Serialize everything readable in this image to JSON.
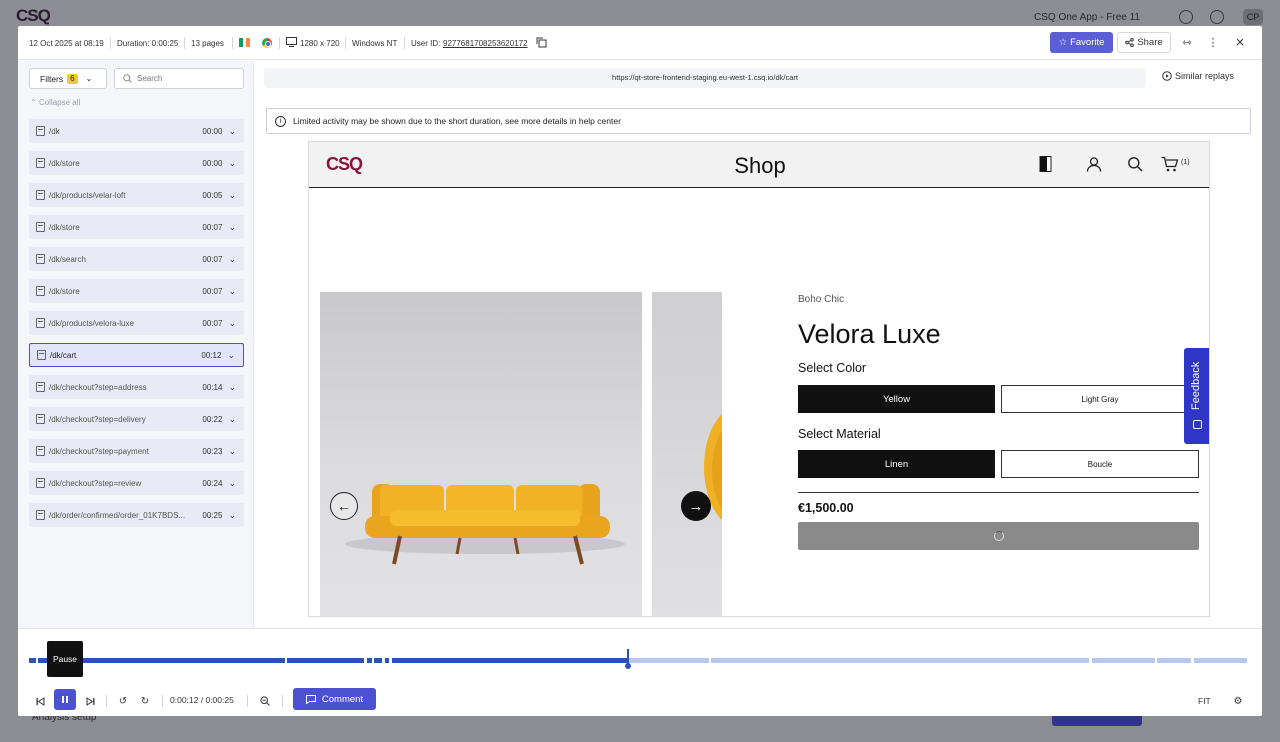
{
  "background": {
    "logo": "CSQ",
    "app_name": "CSQ One App - Free 11",
    "avatar": "CP",
    "bottom_left": "Analysis setup"
  },
  "header": {
    "date": "12 Oct 2025 at 08:19",
    "duration": "Duration: 0:00:25",
    "pages_count": "13 pages",
    "resolution": "1280 x 720",
    "os": "Windows NT",
    "user_id_label": "User ID:",
    "user_id": "9277681708253620172",
    "favorite_label": "Favorite",
    "share_label": "Share"
  },
  "sidebar": {
    "filters_label": "Filters",
    "filters_count": "6",
    "search_placeholder": "Search",
    "collapse_label": "Collapse all",
    "pages": [
      {
        "path": "/dk",
        "time": "00:00"
      },
      {
        "path": "/dk/store",
        "time": "00:00"
      },
      {
        "path": "/dk/products/velar-loft",
        "time": "00:05"
      },
      {
        "path": "/dk/store",
        "time": "00:07"
      },
      {
        "path": "/dk/search",
        "time": "00:07"
      },
      {
        "path": "/dk/store",
        "time": "00:07"
      },
      {
        "path": "/dk/products/velora-luxe",
        "time": "00:07"
      },
      {
        "path": "/dk/cart",
        "time": "00:12",
        "active": true
      },
      {
        "path": "/dk/checkout?step=address",
        "time": "00:14"
      },
      {
        "path": "/dk/checkout?step=delivery",
        "time": "00:22"
      },
      {
        "path": "/dk/checkout?step=payment",
        "time": "00:23"
      },
      {
        "path": "/dk/checkout?step=review",
        "time": "00:24"
      },
      {
        "path": "/dk/order/confirmed/order_01K7BDS...",
        "time": "00:25"
      }
    ]
  },
  "main": {
    "url": "https://qt-store-frontend-staging.eu-west-1.csq.io/dk/cart",
    "similar_label": "Similar replays",
    "notice": "Limited activity may be shown due to the short duration, see more details in help center"
  },
  "replay": {
    "logo": "CSQ",
    "title": "Shop",
    "cart_count": "(1)",
    "brand": "Boho Chic",
    "product_name": "Velora Luxe",
    "color_label": "Select Color",
    "colors": [
      "Yellow",
      "Light Gray"
    ],
    "material_label": "Select Material",
    "materials": [
      "Linen",
      "Boucle"
    ],
    "price": "€1,500.00",
    "feedback_label": "Feedback"
  },
  "timeline": {
    "tooltip": "Pause",
    "current_time": "0:00:12",
    "total_time": "0:00:25",
    "time_separator": " / ",
    "progress": 0.48,
    "comment_label": "Comment",
    "fit_label": "FIT"
  },
  "colors": {
    "accent": "#4c51cf",
    "timeline_played": "#2b52b8",
    "timeline_rest": "#b7c7ee",
    "brand": "#8a1538"
  }
}
